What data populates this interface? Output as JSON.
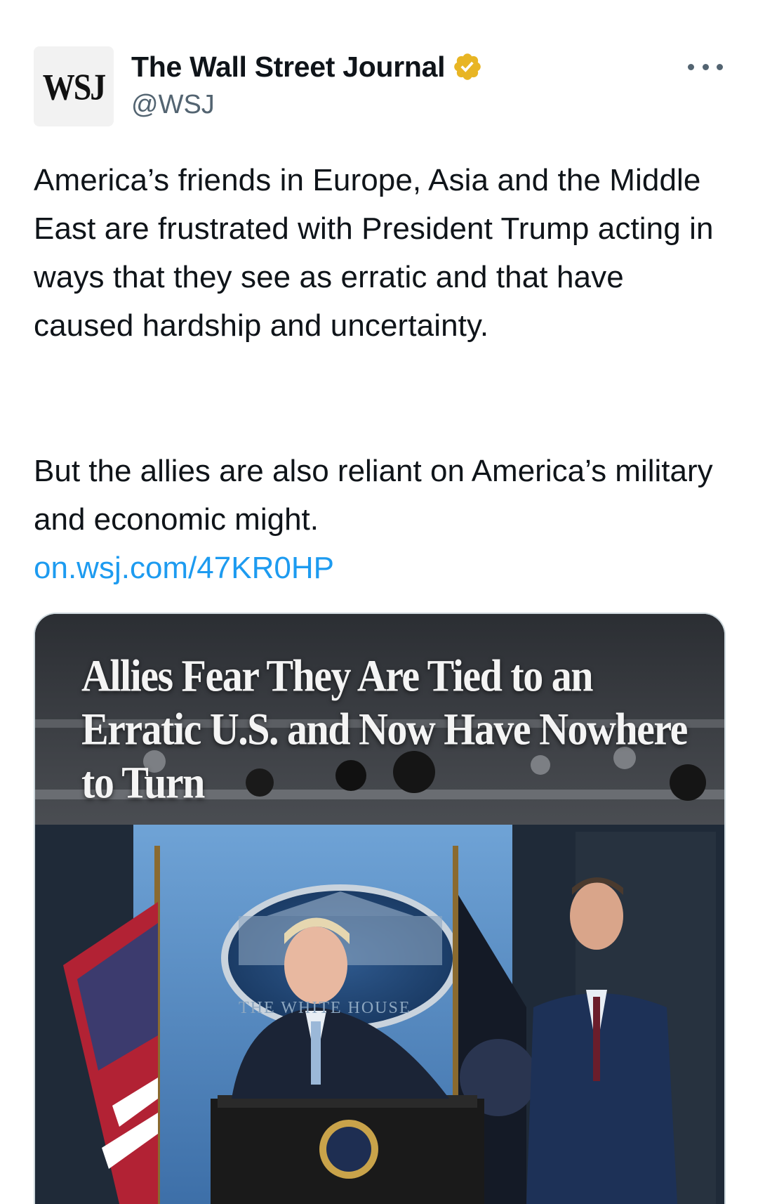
{
  "account": {
    "avatar_text": "WSJ",
    "display_name": "The Wall Street Journal",
    "handle": "@WSJ",
    "verified_badge_color": "#e8b524"
  },
  "tweet": {
    "paragraph1": "America’s friends in Europe, Asia and the Middle East are frustrated with President Trump acting in ways that they see as erratic and that have caused hardship and uncertainty.",
    "paragraph2": "But the allies are also reliant on America’s military and economic might.",
    "link_text": "on.wsj.com/47KR0HP",
    "link_color": "#1d9bf0"
  },
  "media": {
    "headline": "Allies Fear They Are Tied to an Erratic U.S. and Now Have Nowhere to Turn",
    "sign_text": "THE WHITE HOUSE",
    "image_description_icon": "photo-press-briefing"
  },
  "icons": {
    "more": "more-horizontal-icon",
    "verified": "verified-badge-icon"
  }
}
